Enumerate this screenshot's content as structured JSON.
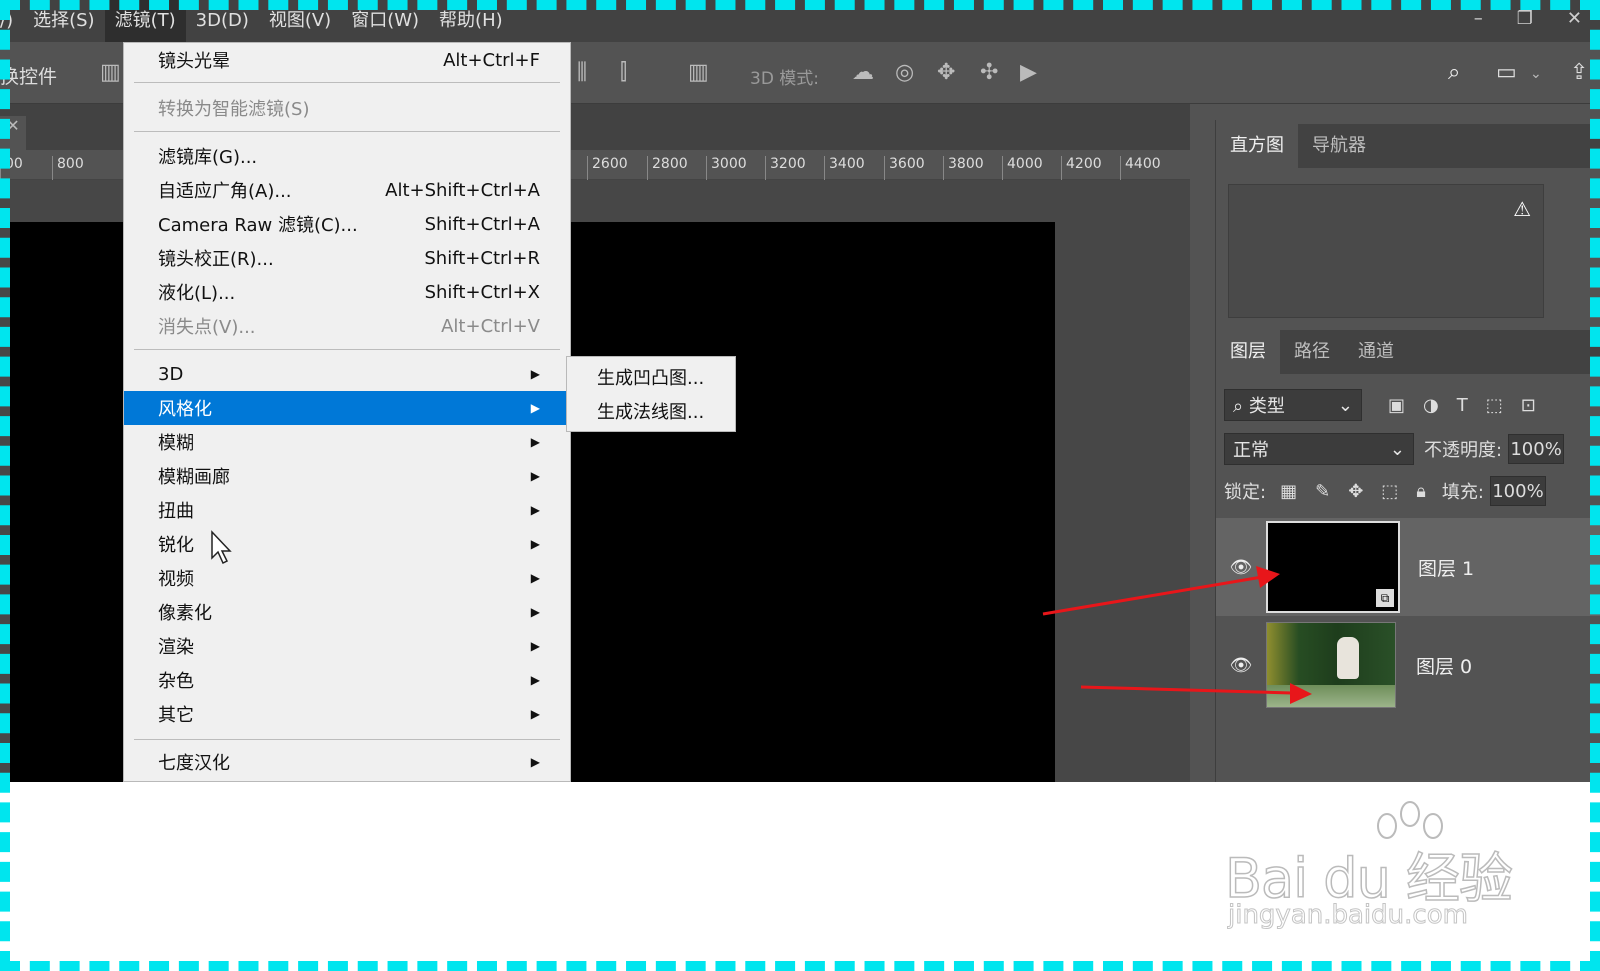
{
  "menubar": {
    "items": [
      "/)",
      "选择(S)",
      "滤镜(T)",
      "3D(D)",
      "视图(V)",
      "窗口(W)",
      "帮助(H)"
    ],
    "window_controls": [
      "–",
      "❐",
      "✕"
    ]
  },
  "optionsbar": {
    "label": "换控件",
    "mode3d": "3D 模式:"
  },
  "ruler": [
    "800",
    "2600",
    "2800",
    "3000",
    "3200",
    "3400",
    "3600",
    "3800",
    "4000",
    "4200",
    "4400",
    "00"
  ],
  "filter_menu": {
    "items": [
      {
        "label": "镜头光晕",
        "shortcut": "Alt+Ctrl+F"
      },
      {
        "label": "转换为智能滤镜(S)",
        "shortcut": ""
      },
      {
        "label": "滤镜库(G)...",
        "shortcut": ""
      },
      {
        "label": "自适应广角(A)...",
        "shortcut": "Alt+Shift+Ctrl+A"
      },
      {
        "label": "Camera Raw 滤镜(C)...",
        "shortcut": "Shift+Ctrl+A"
      },
      {
        "label": "镜头校正(R)...",
        "shortcut": "Shift+Ctrl+R"
      },
      {
        "label": "液化(L)...",
        "shortcut": "Shift+Ctrl+X"
      },
      {
        "label": "消失点(V)...",
        "shortcut": "Alt+Ctrl+V"
      },
      {
        "label": "3D",
        "shortcut": ""
      },
      {
        "label": "风格化",
        "shortcut": ""
      },
      {
        "label": "模糊",
        "shortcut": ""
      },
      {
        "label": "模糊画廊",
        "shortcut": ""
      },
      {
        "label": "扭曲",
        "shortcut": ""
      },
      {
        "label": "锐化",
        "shortcut": ""
      },
      {
        "label": "视频",
        "shortcut": ""
      },
      {
        "label": "像素化",
        "shortcut": ""
      },
      {
        "label": "渲染",
        "shortcut": ""
      },
      {
        "label": "杂色",
        "shortcut": ""
      },
      {
        "label": "其它",
        "shortcut": ""
      },
      {
        "label": "七度汉化",
        "shortcut": ""
      }
    ]
  },
  "submenu": {
    "items": [
      "生成凹凸图...",
      "生成法线图..."
    ]
  },
  "histogram_panel": {
    "tabs": [
      "直方图",
      "导航器"
    ]
  },
  "layers_panel": {
    "tabs": [
      "图层",
      "路径",
      "通道"
    ],
    "filter_kind": "类型",
    "blend_mode": "正常",
    "opacity_label": "不透明度:",
    "opacity_value": "100%",
    "lock_label": "锁定:",
    "fill_label": "填充:",
    "fill_value": "100%",
    "layers": [
      {
        "name": "图层 1"
      },
      {
        "name": "图层 0"
      }
    ]
  },
  "watermark": {
    "brand": "Bai du 经验",
    "url": "jingyan.baidu.com"
  },
  "colors": {
    "highlight": "#0078d7",
    "arrow": "#e8161a",
    "frame": "#00e5ee"
  }
}
